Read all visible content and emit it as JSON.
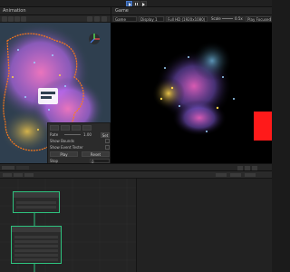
{
  "toolbar": {
    "play_icon": "play-icon",
    "pause_icon": "pause-icon",
    "step_icon": "step-icon"
  },
  "scene": {
    "tab_label": "Animation"
  },
  "game": {
    "tab_label": "Game",
    "display": "Display 1",
    "resolution": "Full HD (1920x1080)",
    "scale_label": "Scale",
    "scale_value": "0.5x",
    "play_mode": "Play Focused"
  },
  "vfx_panel": {
    "rate_label": "Rate",
    "rate_value": "1.00",
    "set_label": "Set",
    "show_bounds": "Show Bounds",
    "show_event_tester": "Show Event Tester",
    "play_button": "Play",
    "reset_button": "Reset",
    "stop_label": "Stop",
    "stop_value": "0"
  },
  "colors": {
    "accent_node_border": "#2ec27e",
    "game_red_box": "#ff1a1a",
    "orange_outline": "#ff7a1a"
  }
}
